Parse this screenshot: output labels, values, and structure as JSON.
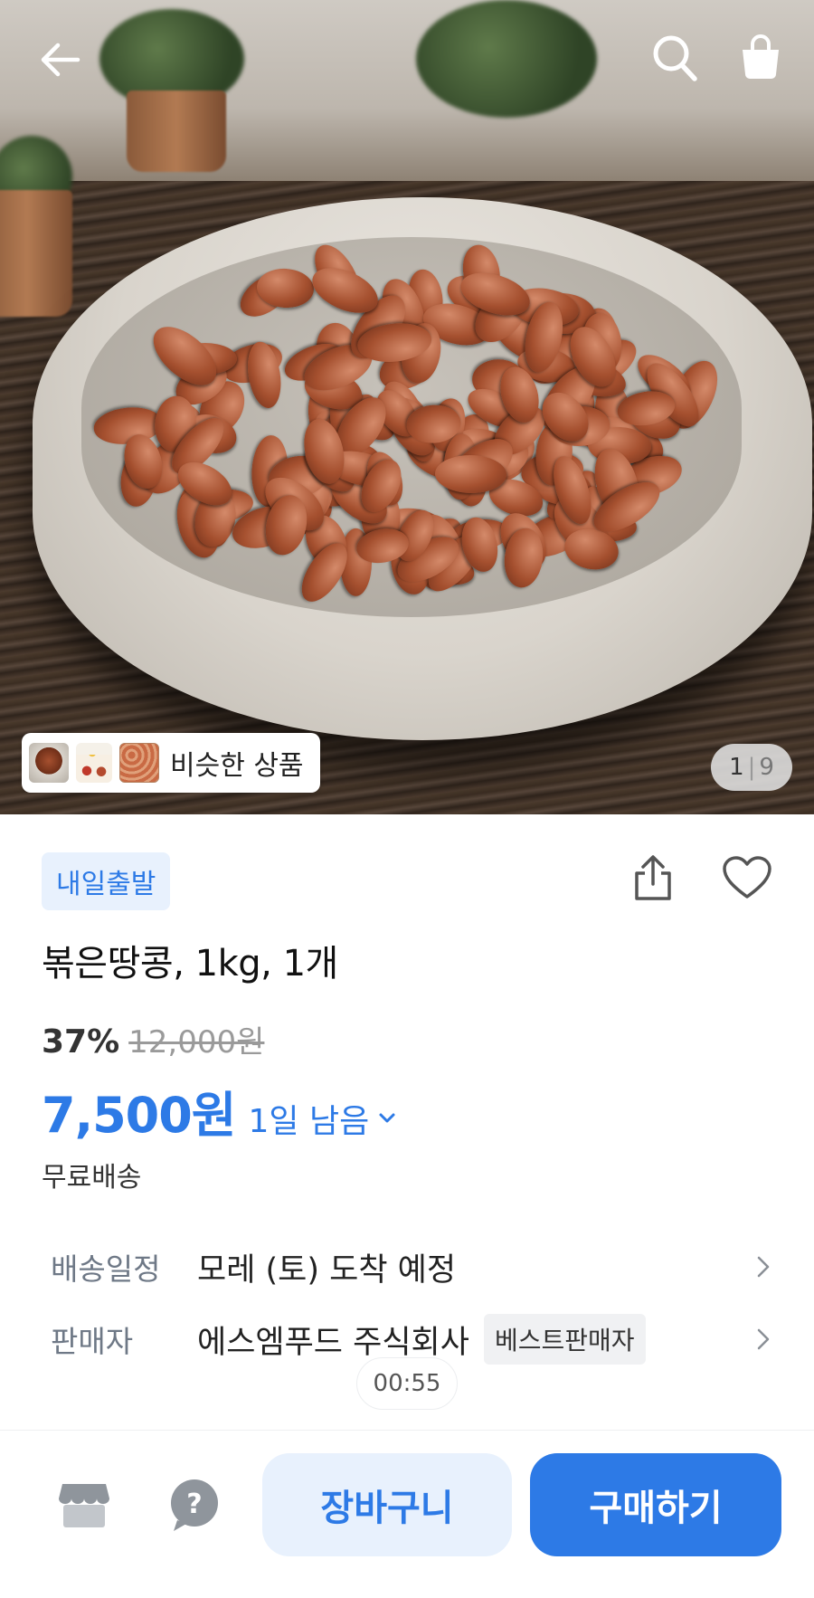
{
  "header": {
    "back_icon": "arrow-left-icon",
    "search_icon": "search-icon",
    "cart_icon": "shopping-bag-icon"
  },
  "gallery": {
    "similar_label": "비슷한 상품",
    "current_page": "1",
    "separator": "|",
    "total_pages": "9"
  },
  "product": {
    "dispatch_badge": "내일출발",
    "title": "볶은땅콩, 1kg, 1개",
    "discount": "37%",
    "original_price": "12,000원",
    "sale_price": "7,500원",
    "remaining": "1일 남음",
    "shipping": "무료배송"
  },
  "info": {
    "delivery_label": "배송일정",
    "delivery_value": "모레 (토) 도착 예정",
    "seller_label": "판매자",
    "seller_value": "에스엠푸드 주식회사",
    "seller_badge": "베스트판매자"
  },
  "timer": "00:55",
  "actions": {
    "cart_label": "장바구니",
    "buy_label": "구매하기"
  },
  "colors": {
    "accent": "#2d7ae6",
    "accent_light": "#e8f1fd"
  }
}
